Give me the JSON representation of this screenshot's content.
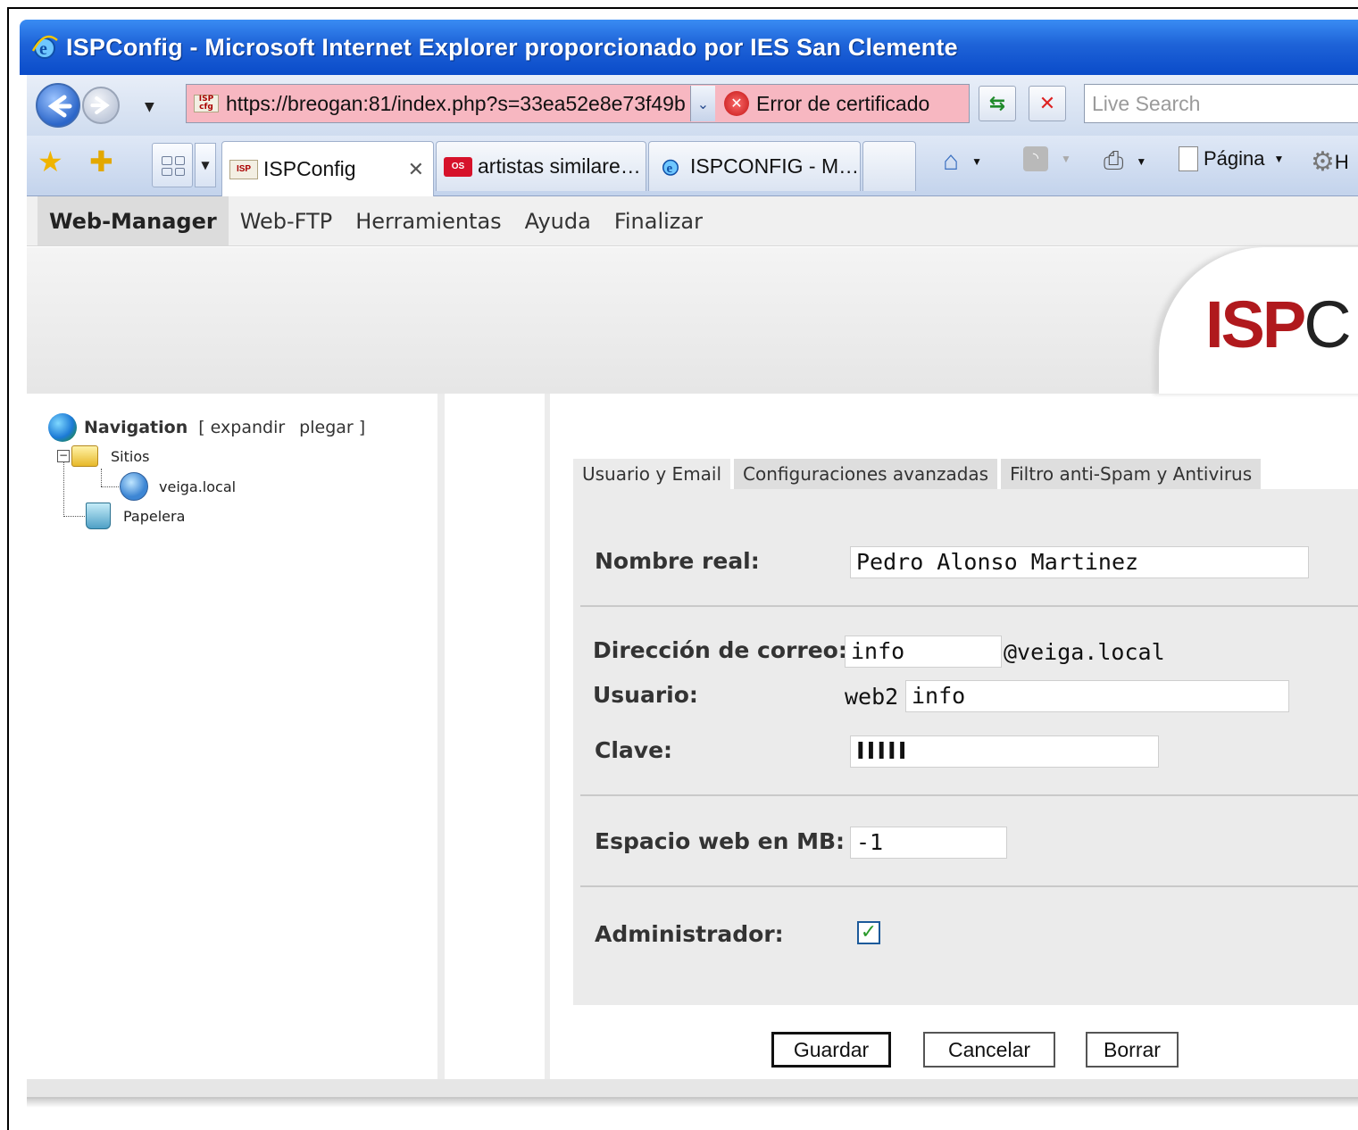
{
  "window": {
    "title": "ISPConfig - Microsoft Internet Explorer proporcionado por IES San Clemente"
  },
  "addressbar": {
    "url": "https://breogan:81/index.php?s=33ea52e8e73f49b",
    "cert_error": "Error de certificado",
    "search_placeholder": "Live Search"
  },
  "browser_tabs": [
    {
      "label": "ISPConfig",
      "active": true
    },
    {
      "label": "artistas similare…",
      "active": false
    },
    {
      "label": "ISPCONFIG - M…",
      "active": false
    }
  ],
  "commandbar": {
    "page_label": "Página",
    "tools_partial": "H"
  },
  "app_menu": [
    "Web-Manager",
    "Web-FTP",
    "Herramientas",
    "Ayuda",
    "Finalizar"
  ],
  "logo": {
    "brand_red": "ISP",
    "brand_dark": "C"
  },
  "navigation": {
    "title": "Navigation",
    "expand": "[ expandir",
    "collapse": "plegar ]",
    "tree": [
      {
        "label": "Sitios",
        "level": 1
      },
      {
        "label": "veiga.local",
        "level": 2
      },
      {
        "label": "Papelera",
        "level": 1
      }
    ]
  },
  "form_tabs": [
    "Usuario y Email",
    "Configuraciones avanzadas",
    "Filtro anti-Spam y Antivirus"
  ],
  "form": {
    "nombre_real_label": "Nombre real:",
    "nombre_real_value": "Pedro Alonso Martinez",
    "correo_label": "Dirección de correo:",
    "correo_value": "info",
    "correo_domain": "@veiga.local",
    "usuario_label": "Usuario:",
    "usuario_prefix": "web2",
    "usuario_value": "info",
    "clave_label": "Clave:",
    "clave_value": "IIIII",
    "espacio_label": "Espacio web en MB:",
    "espacio_value": "-1",
    "admin_label": "Administrador:",
    "admin_checked": true
  },
  "buttons": {
    "guardar": "Guardar",
    "cancelar": "Cancelar",
    "borrar": "Borrar"
  },
  "colors": {
    "title_bar": "#1e63d8",
    "cert_error_bg": "#f7b7c1",
    "logo_red": "#b0191d"
  }
}
